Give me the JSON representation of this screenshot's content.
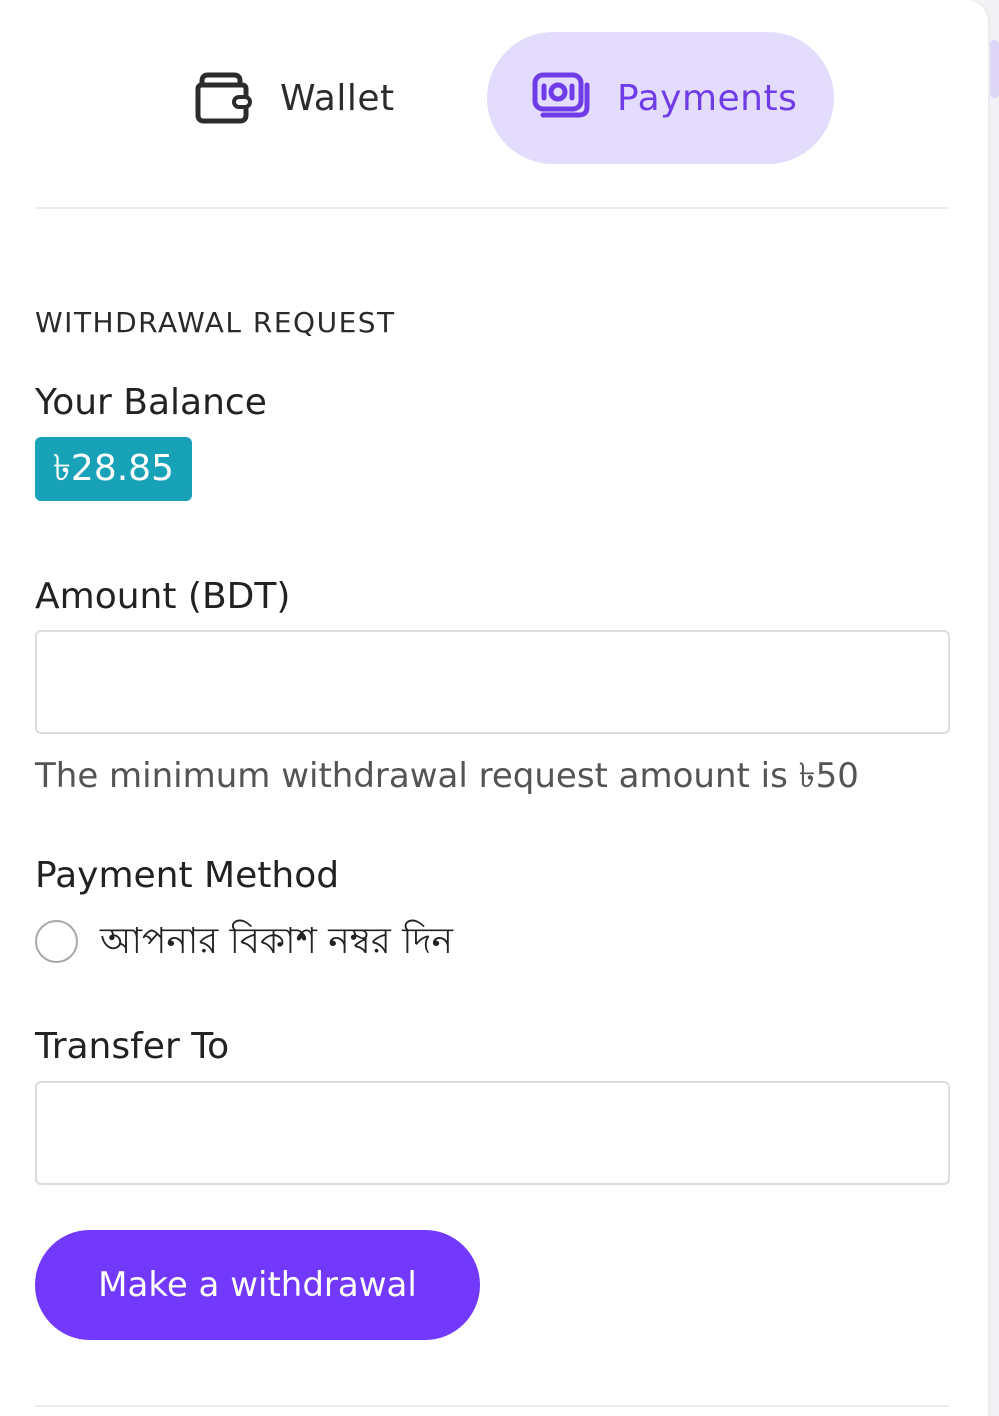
{
  "tabs": {
    "wallet": {
      "label": "Wallet",
      "icon": "wallet-icon"
    },
    "payments": {
      "label": "Payments",
      "icon": "money-icon",
      "active": true
    }
  },
  "withdrawal": {
    "section_title": "WITHDRAWAL REQUEST",
    "balance_label": "Your Balance",
    "balance_value": "৳28.85",
    "amount_label": "Amount (BDT)",
    "amount_value": "",
    "amount_help": "The minimum withdrawal request amount is ৳50",
    "payment_method_label": "Payment Method",
    "payment_option_label": "আপনার বিকাশ নম্বর দিন",
    "payment_option_selected": false,
    "transfer_label": "Transfer To",
    "transfer_value": "",
    "submit_label": "Make a withdrawal"
  },
  "colors": {
    "accent": "#7239fc",
    "active_tab_bg": "#e4dcfd",
    "active_tab_text": "#6f3de8",
    "balance_badge": "#17a2b8"
  }
}
